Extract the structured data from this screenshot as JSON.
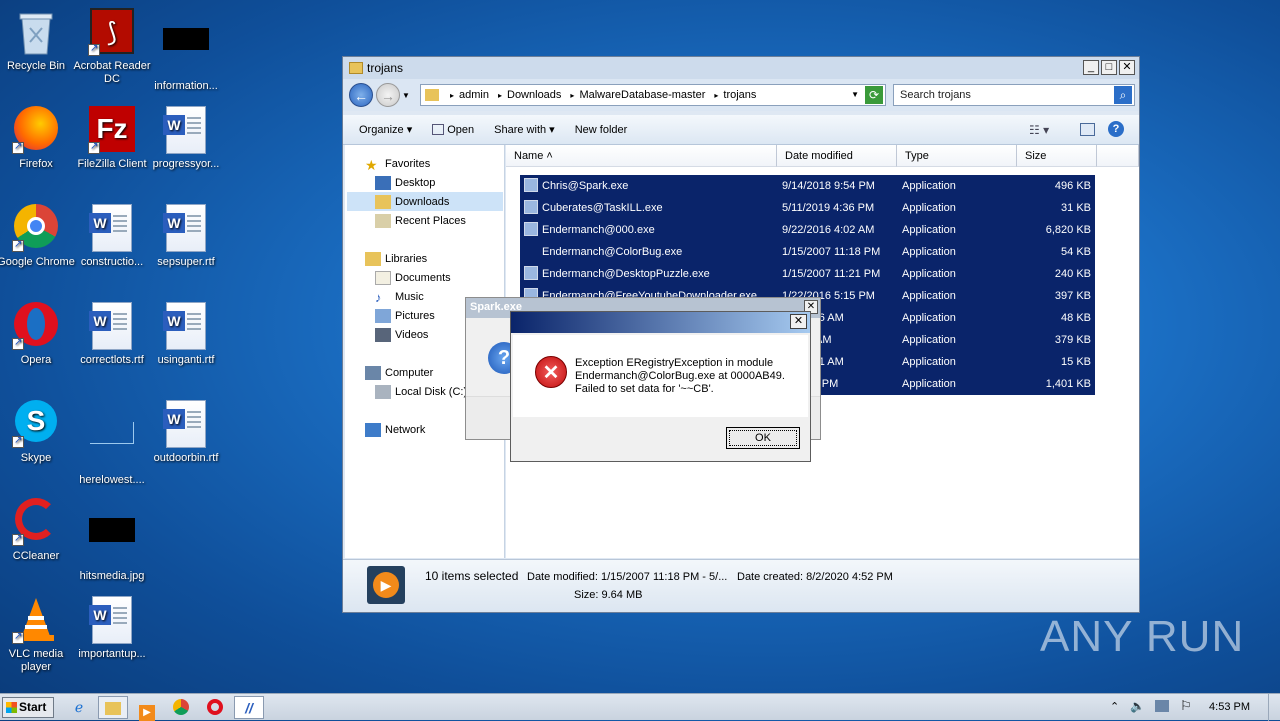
{
  "desktop": {
    "icons": [
      {
        "label": "Recycle Bin"
      },
      {
        "label": "Acrobat Reader DC"
      },
      {
        "label": "information..."
      },
      {
        "label": "Firefox"
      },
      {
        "label": "FileZilla Client"
      },
      {
        "label": "progressyor..."
      },
      {
        "label": "Google Chrome"
      },
      {
        "label": "constructio..."
      },
      {
        "label": "sepsuper.rtf"
      },
      {
        "label": "Opera"
      },
      {
        "label": "correctlots.rtf"
      },
      {
        "label": "usinganti.rtf"
      },
      {
        "label": "Skype"
      },
      {
        "label": "herelowest...."
      },
      {
        "label": "outdoorbin.rtf"
      },
      {
        "label": "CCleaner"
      },
      {
        "label": "hitsmedia.jpg"
      },
      {
        "label": "VLC media player"
      },
      {
        "label": "importantup..."
      }
    ]
  },
  "explorer": {
    "title": "trojans",
    "breadcrumb": [
      "admin",
      "Downloads",
      "MalwareDatabase-master",
      "trojans"
    ],
    "search_placeholder": "Search trojans",
    "toolbar": {
      "organize": "Organize",
      "open": "Open",
      "share_with": "Share with",
      "new_folder": "New folder"
    },
    "nav": {
      "favorites": "Favorites",
      "desktop": "Desktop",
      "downloads": "Downloads",
      "recent": "Recent Places",
      "libraries": "Libraries",
      "documents": "Documents",
      "music": "Music",
      "pictures": "Pictures",
      "videos": "Videos",
      "computer": "Computer",
      "local_disk": "Local Disk (C:)",
      "network": "Network"
    },
    "columns": {
      "name": "Name",
      "date": "Date modified",
      "type": "Type",
      "size": "Size"
    },
    "files": [
      {
        "name": "Chris@Spark.exe",
        "date": "9/14/2018 9:54 PM",
        "type": "Application",
        "size": "496 KB"
      },
      {
        "name": "Cuberates@TaskILL.exe",
        "date": "5/11/2019 4:36 PM",
        "type": "Application",
        "size": "31 KB"
      },
      {
        "name": "Endermanch@000.exe",
        "date": "9/22/2016 4:02 AM",
        "type": "Application",
        "size": "6,820 KB"
      },
      {
        "name": "Endermanch@ColorBug.exe",
        "date": "1/15/2007 11:18 PM",
        "type": "Application",
        "size": "54 KB"
      },
      {
        "name": "Endermanch@DesktopPuzzle.exe",
        "date": "1/15/2007 11:21 PM",
        "type": "Application",
        "size": "240 KB"
      },
      {
        "name": "Endermanch@FreeYoutubeDownloader.exe",
        "date": "1/22/2016 5:15 PM",
        "type": "Application",
        "size": "397 KB"
      },
      {
        "name": "",
        "date": "014 5:46 AM",
        "type": "Application",
        "size": "48 KB"
      },
      {
        "name": "",
        "date": "6 9:28 AM",
        "type": "Application",
        "size": "379 KB"
      },
      {
        "name": "",
        "date": "16 10:51 AM",
        "type": "Application",
        "size": "15 KB"
      },
      {
        "name": "",
        "date": "18 1:18 PM",
        "type": "Application",
        "size": "1,401 KB"
      }
    ],
    "status": {
      "selected": "10 items selected",
      "date_modified": "Date modified: 1/15/2007 11:18 PM - 5/...",
      "date_created": "Date created: 8/2/2020 4:52 PM",
      "size": "Size: 9.64 MB"
    }
  },
  "spark_window": {
    "title": "Spark.exe"
  },
  "error_dialog": {
    "message": "Exception ERegistryException in module\nEndermanch@ColorBug.exe at 0000AB49.\nFailed to set data for '~~CB'.",
    "ok": "OK"
  },
  "taskbar": {
    "start": "Start",
    "clock": "4:53 PM"
  },
  "watermark": "ANY RUN"
}
